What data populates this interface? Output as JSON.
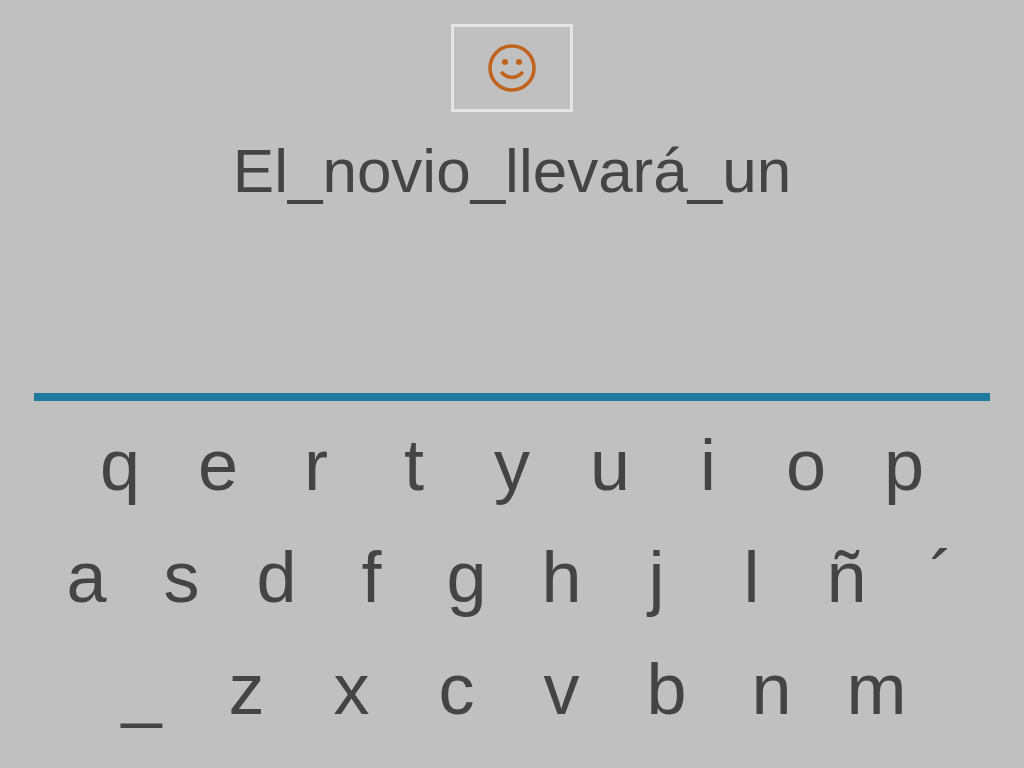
{
  "sentence": "El_novio_llevará_un",
  "keyboard": {
    "rows": [
      [
        "q",
        "e",
        "r",
        "t",
        "y",
        "u",
        "i",
        "o",
        "p"
      ],
      [
        "a",
        "s",
        "d",
        "f",
        "g",
        "h",
        "j",
        "l",
        "ñ",
        "´"
      ],
      [
        "_",
        "z",
        "x",
        "c",
        "v",
        "b",
        "n",
        "m"
      ]
    ]
  }
}
